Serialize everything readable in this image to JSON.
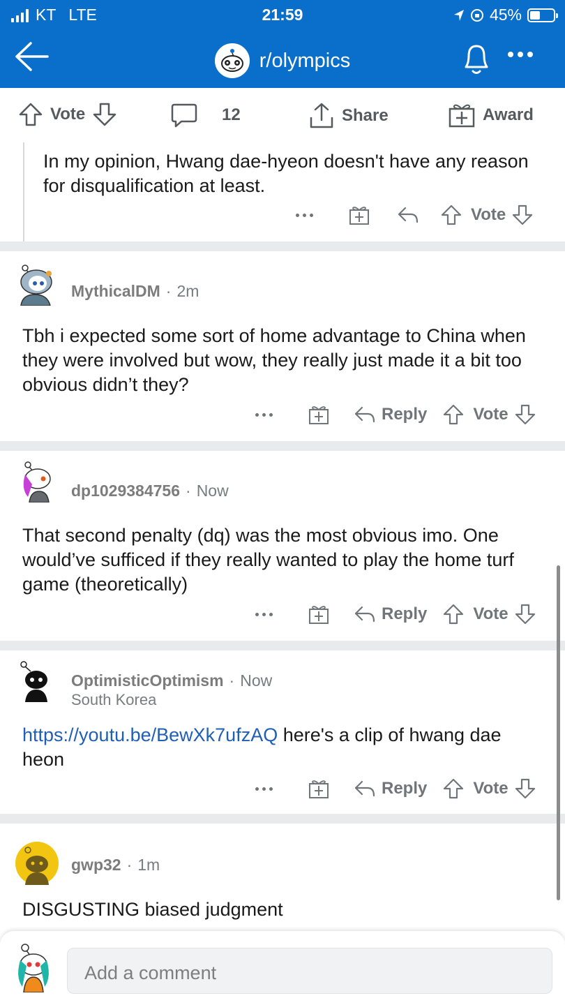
{
  "status": {
    "carrier": "KT",
    "network": "LTE",
    "time": "21:59",
    "battery": "45%",
    "battery_level": 0.45
  },
  "nav": {
    "subreddit": "r/olympics"
  },
  "post_actions": {
    "vote": "Vote",
    "comments": "12",
    "share": "Share",
    "award": "Award"
  },
  "comments": [
    {
      "body": "In my opinion, Hwang dae-hyeon doesn't have any reason for disqualification at least.",
      "vote": "Vote"
    },
    {
      "author": "MythicalDM",
      "time": "2m",
      "body": "Tbh i expected some sort of home advantage to China when they were involved but wow, they really just made it a bit too obvious didn’t they?",
      "reply": "Reply",
      "vote": "Vote"
    },
    {
      "author": "dp1029384756",
      "time": "Now",
      "body": "That second penalty (dq) was the most obvious imo. One would’ve sufficed if they really wanted to play the home turf game (theoretically)",
      "reply": "Reply",
      "vote": "Vote"
    },
    {
      "author": "OptimisticOptimism",
      "time": "Now",
      "flair": "South Korea",
      "link": "https://youtu.be/BewXk7ufzAQ",
      "body": " here's a clip of hwang dae heon",
      "reply": "Reply",
      "vote": "Vote"
    },
    {
      "author": "gwp32",
      "time": "1m",
      "body": "DISGUSTING biased judgment"
    }
  ],
  "composer": {
    "placeholder": "Add a comment"
  },
  "colors": {
    "brand": "#0a6fcb",
    "link": "#1f5fb5"
  }
}
